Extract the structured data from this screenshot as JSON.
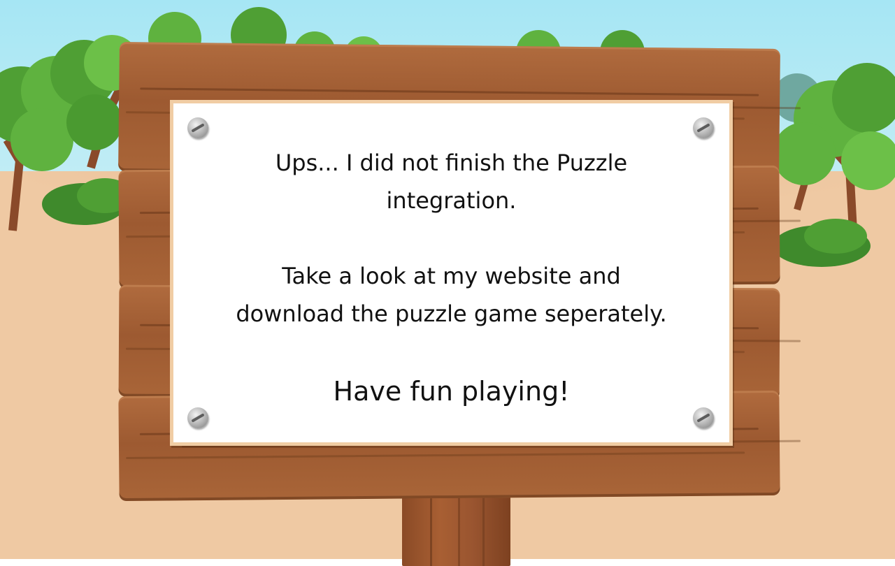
{
  "sign": {
    "message_line1a": "Ups... I did not finish the Puzzle",
    "message_line1b": "integration.",
    "message_line2a": "Take a look at my website and",
    "message_line2b": "download the puzzle game seperately.",
    "message_line3": "Have fun playing!"
  },
  "colors": {
    "sky": "#a6e6f4",
    "ground": "#efc9a3",
    "wood": "#a5613a",
    "panel": "#ffffff",
    "panel_border": "#f1cda4",
    "text": "#111111",
    "foliage": "#5fb23f"
  },
  "decor": {
    "screw_icon": "screw-icon",
    "tree_icon": "tree-icon",
    "bush_icon": "bush-icon"
  }
}
